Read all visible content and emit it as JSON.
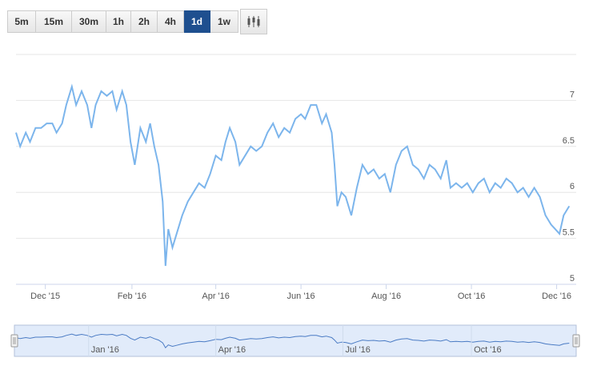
{
  "toolbar": {
    "intervals": [
      "5m",
      "15m",
      "30m",
      "1h",
      "2h",
      "4h",
      "1d",
      "1w"
    ],
    "active": "1d",
    "chart_type_icon": "candlestick-icon"
  },
  "colors": {
    "line": "#7cb5ec",
    "grid": "#e6e6e6",
    "navigator_fill": "#c8daf5",
    "active_button": "#1e4f8f"
  },
  "chart_data": {
    "type": "line",
    "y_ticks": [
      "5",
      "5.5",
      "6",
      "6.5",
      "7"
    ],
    "ylim": [
      5,
      7.5
    ],
    "x_ticks": [
      "Dec '15",
      "Feb '16",
      "Apr '16",
      "Jun '16",
      "Aug '16",
      "Oct '16",
      "Dec '16"
    ],
    "x_start": "2015-11-10",
    "x_end": "2016-12-15",
    "grid": true,
    "series": [
      {
        "points": [
          [
            "2015-11-10",
            6.65
          ],
          [
            "2015-11-13",
            6.5
          ],
          [
            "2015-11-17",
            6.65
          ],
          [
            "2015-11-20",
            6.55
          ],
          [
            "2015-11-24",
            6.7
          ],
          [
            "2015-11-28",
            6.7
          ],
          [
            "2015-12-02",
            6.75
          ],
          [
            "2015-12-06",
            6.75
          ],
          [
            "2015-12-09",
            6.65
          ],
          [
            "2015-12-13",
            6.75
          ],
          [
            "2015-12-16",
            6.95
          ],
          [
            "2015-12-20",
            7.15
          ],
          [
            "2015-12-23",
            6.95
          ],
          [
            "2015-12-27",
            7.1
          ],
          [
            "2015-12-31",
            6.95
          ],
          [
            "2016-01-03",
            6.7
          ],
          [
            "2016-01-06",
            6.95
          ],
          [
            "2016-01-10",
            7.1
          ],
          [
            "2016-01-14",
            7.05
          ],
          [
            "2016-01-18",
            7.1
          ],
          [
            "2016-01-21",
            6.9
          ],
          [
            "2016-01-25",
            7.1
          ],
          [
            "2016-01-28",
            6.95
          ],
          [
            "2016-01-31",
            6.55
          ],
          [
            "2016-02-03",
            6.3
          ],
          [
            "2016-02-07",
            6.7
          ],
          [
            "2016-02-11",
            6.55
          ],
          [
            "2016-02-14",
            6.75
          ],
          [
            "2016-02-17",
            6.5
          ],
          [
            "2016-02-20",
            6.3
          ],
          [
            "2016-02-23",
            5.9
          ],
          [
            "2016-02-25",
            5.2
          ],
          [
            "2016-02-27",
            5.6
          ],
          [
            "2016-03-01",
            5.4
          ],
          [
            "2016-03-04",
            5.55
          ],
          [
            "2016-03-08",
            5.75
          ],
          [
            "2016-03-12",
            5.9
          ],
          [
            "2016-03-16",
            6.0
          ],
          [
            "2016-03-20",
            6.1
          ],
          [
            "2016-03-24",
            6.05
          ],
          [
            "2016-03-28",
            6.2
          ],
          [
            "2016-04-01",
            6.4
          ],
          [
            "2016-04-05",
            6.35
          ],
          [
            "2016-04-08",
            6.55
          ],
          [
            "2016-04-11",
            6.7
          ],
          [
            "2016-04-15",
            6.55
          ],
          [
            "2016-04-18",
            6.3
          ],
          [
            "2016-04-22",
            6.4
          ],
          [
            "2016-04-26",
            6.5
          ],
          [
            "2016-04-30",
            6.45
          ],
          [
            "2016-05-04",
            6.5
          ],
          [
            "2016-05-08",
            6.65
          ],
          [
            "2016-05-12",
            6.75
          ],
          [
            "2016-05-16",
            6.6
          ],
          [
            "2016-05-20",
            6.7
          ],
          [
            "2016-05-24",
            6.65
          ],
          [
            "2016-05-28",
            6.8
          ],
          [
            "2016-06-01",
            6.85
          ],
          [
            "2016-06-04",
            6.8
          ],
          [
            "2016-06-08",
            6.95
          ],
          [
            "2016-06-12",
            6.95
          ],
          [
            "2016-06-16",
            6.75
          ],
          [
            "2016-06-19",
            6.85
          ],
          [
            "2016-06-23",
            6.65
          ],
          [
            "2016-06-25",
            6.3
          ],
          [
            "2016-06-27",
            5.85
          ],
          [
            "2016-06-30",
            6.0
          ],
          [
            "2016-07-03",
            5.95
          ],
          [
            "2016-07-07",
            5.75
          ],
          [
            "2016-07-11",
            6.05
          ],
          [
            "2016-07-15",
            6.3
          ],
          [
            "2016-07-19",
            6.2
          ],
          [
            "2016-07-23",
            6.25
          ],
          [
            "2016-07-27",
            6.15
          ],
          [
            "2016-07-31",
            6.2
          ],
          [
            "2016-08-04",
            6.0
          ],
          [
            "2016-08-08",
            6.3
          ],
          [
            "2016-08-12",
            6.45
          ],
          [
            "2016-08-16",
            6.5
          ],
          [
            "2016-08-20",
            6.3
          ],
          [
            "2016-08-24",
            6.25
          ],
          [
            "2016-08-28",
            6.15
          ],
          [
            "2016-09-01",
            6.3
          ],
          [
            "2016-09-05",
            6.25
          ],
          [
            "2016-09-09",
            6.15
          ],
          [
            "2016-09-13",
            6.35
          ],
          [
            "2016-09-16",
            6.05
          ],
          [
            "2016-09-20",
            6.1
          ],
          [
            "2016-09-24",
            6.05
          ],
          [
            "2016-09-28",
            6.1
          ],
          [
            "2016-10-02",
            6.0
          ],
          [
            "2016-10-06",
            6.1
          ],
          [
            "2016-10-10",
            6.15
          ],
          [
            "2016-10-14",
            6.0
          ],
          [
            "2016-10-18",
            6.1
          ],
          [
            "2016-10-22",
            6.05
          ],
          [
            "2016-10-26",
            6.15
          ],
          [
            "2016-10-30",
            6.1
          ],
          [
            "2016-11-03",
            6.0
          ],
          [
            "2016-11-07",
            6.05
          ],
          [
            "2016-11-11",
            5.95
          ],
          [
            "2016-11-15",
            6.05
          ],
          [
            "2016-11-19",
            5.95
          ],
          [
            "2016-11-23",
            5.75
          ],
          [
            "2016-11-27",
            5.65
          ],
          [
            "2016-11-30",
            5.6
          ],
          [
            "2016-12-03",
            5.55
          ],
          [
            "2016-12-06",
            5.75
          ],
          [
            "2016-12-10",
            5.85
          ]
        ]
      }
    ]
  },
  "navigator": {
    "x_ticks": [
      "Jan '16",
      "Apr '16",
      "Jul '16",
      "Oct '16"
    ]
  }
}
